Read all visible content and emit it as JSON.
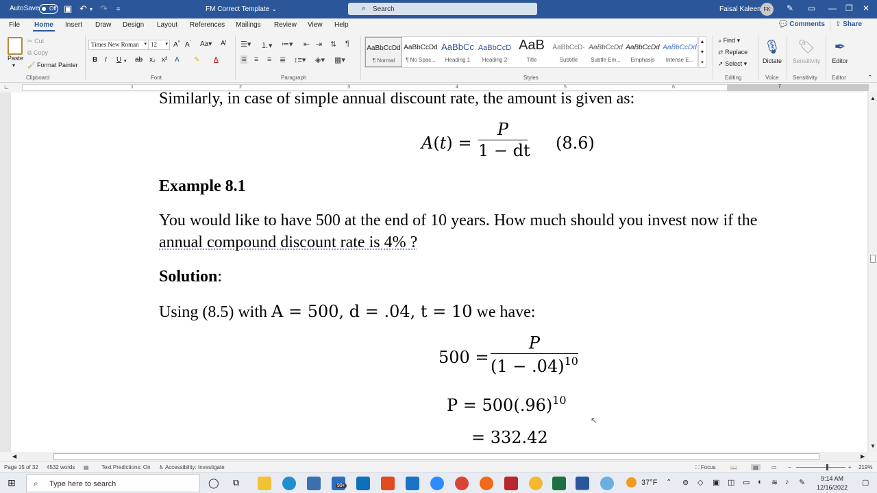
{
  "titlebar": {
    "autosave_label": "AutoSave",
    "autosave_state": "Off",
    "doc_title": "FM Correct Template",
    "search_placeholder": "Search",
    "user_name": "Faisal Kaleem",
    "user_initials": "FK"
  },
  "menu": {
    "tabs": [
      "File",
      "Home",
      "Insert",
      "Draw",
      "Design",
      "Layout",
      "References",
      "Mailings",
      "Review",
      "View",
      "Help"
    ],
    "active": "Home",
    "comments_label": "Comments",
    "share_label": "Share"
  },
  "ribbon": {
    "clipboard": {
      "paste": "Paste",
      "cut": "Cut",
      "copy": "Copy",
      "format_painter": "Format Painter",
      "group_label": "Clipboard"
    },
    "font": {
      "font_name": "Times New Roman",
      "font_size": "12",
      "group_label": "Font"
    },
    "paragraph": {
      "group_label": "Paragraph"
    },
    "styles": {
      "group_label": "Styles",
      "items": [
        {
          "preview": "AaBbCcDd",
          "name": "¶ Normal"
        },
        {
          "preview": "AaBbCcDd",
          "name": "¶ No Spac..."
        },
        {
          "preview": "AaBbCc",
          "name": "Heading 1"
        },
        {
          "preview": "AaBbCcD",
          "name": "Heading 2"
        },
        {
          "preview": "AaB",
          "name": "Title"
        },
        {
          "preview": "AaBbCcD·",
          "name": "Subtitle"
        },
        {
          "preview": "AaBbCcDd",
          "name": "Subtle Em..."
        },
        {
          "preview": "AaBbCcDd",
          "name": "Emphasis"
        },
        {
          "preview": "AaBbCcDd",
          "name": "Intense E..."
        }
      ]
    },
    "editing": {
      "find": "Find",
      "replace": "Replace",
      "select": "Select",
      "group_label": "Editing"
    },
    "voice": {
      "dictate": "Dictate",
      "group_label": "Voice"
    },
    "sensitivity": {
      "label": "Sensitivity",
      "group_label": "Sensitivity"
    },
    "editor": {
      "label": "Editor",
      "group_label": "Editor"
    }
  },
  "ruler": {
    "marks": [
      "1",
      "2",
      "3",
      "4",
      "5",
      "6",
      "7"
    ]
  },
  "document": {
    "line1": "Similarly, in case of simple annual discount rate, the amount is given as:",
    "eq86_lhs": "A(t) =",
    "eq86_num": "P",
    "eq86_den": "1 − dt",
    "eq86_tag": "(8.6)",
    "example_heading": "Example 8.1",
    "example_line1": "You would like to have 500 at the end of 10 years.  How much should you invest now if the",
    "example_line2": "annual compound discount rate is 4% ?",
    "solution_label": "Solution",
    "solution_colon": ":",
    "using_text": "Using (8.5) with",
    "using_vars": "A = 500,  d = .04,  t = 10",
    "using_tail": "we have:",
    "eq_a_lhs": "500 =",
    "eq_a_num": "P",
    "eq_a_den": "(1 − .04)",
    "eq_a_exp": "10",
    "eq_b": "P = 500(.96)",
    "eq_b_exp": "10",
    "eq_c": "= 332.42"
  },
  "status": {
    "page": "Page 15 of 32",
    "words": "4532 words",
    "text_predictions": "Text Predictions: On",
    "accessibility": "Accessibility: Investigate",
    "focus": "Focus",
    "zoom": "219%"
  },
  "taskbar": {
    "search_placeholder": "Type here to search",
    "badge": "99+",
    "weather": "37°F",
    "time": "9:14 AM",
    "date": "12/16/2022"
  }
}
